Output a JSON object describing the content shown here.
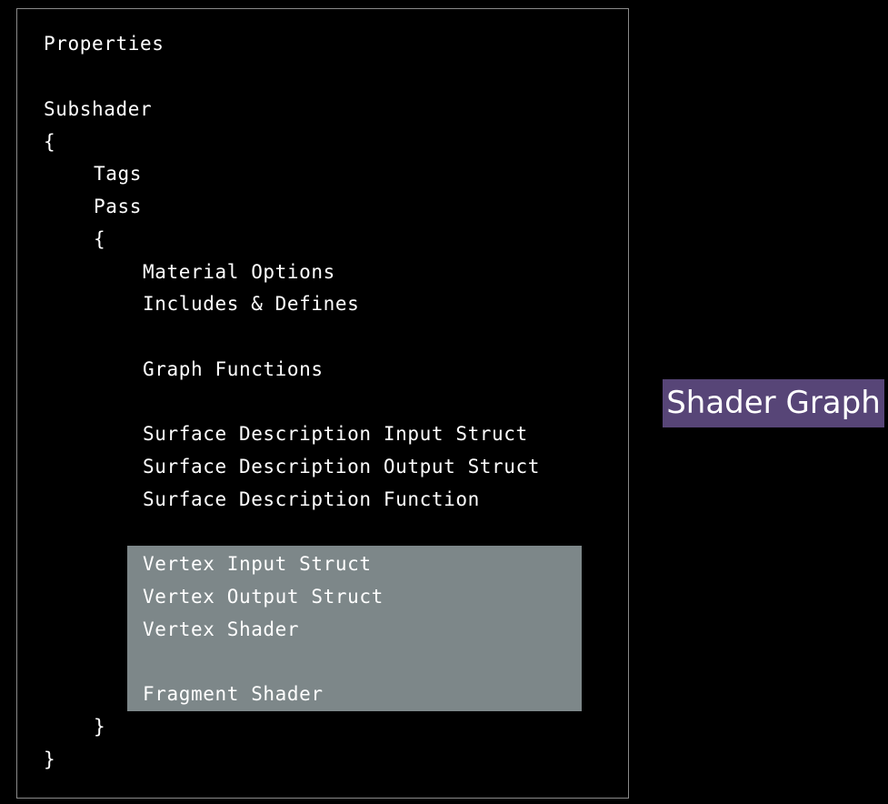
{
  "code": {
    "properties": "Properties",
    "subshader": "Subshader",
    "open_brace_outer": "{",
    "tags": "Tags",
    "pass": "Pass",
    "open_brace_inner": "{",
    "material_options": "Material Options",
    "includes_defines": "Includes & Defines",
    "graph_functions": "Graph Functions",
    "surface_input_struct": "Surface Description Input Struct",
    "surface_output_struct": "Surface Description Output Struct",
    "surface_function": "Surface Description Function",
    "vertex_input_struct": "Vertex Input Struct",
    "vertex_output_struct": "Vertex Output Struct",
    "vertex_shader": "Vertex Shader",
    "fragment_shader": "Fragment Shader",
    "close_brace_inner": "}",
    "close_brace_outer": "}"
  },
  "badge": {
    "label": "Shader Graph"
  },
  "colors": {
    "background": "#000000",
    "highlight": "#7d8789",
    "badge": "#574577",
    "text": "#ffffff"
  }
}
